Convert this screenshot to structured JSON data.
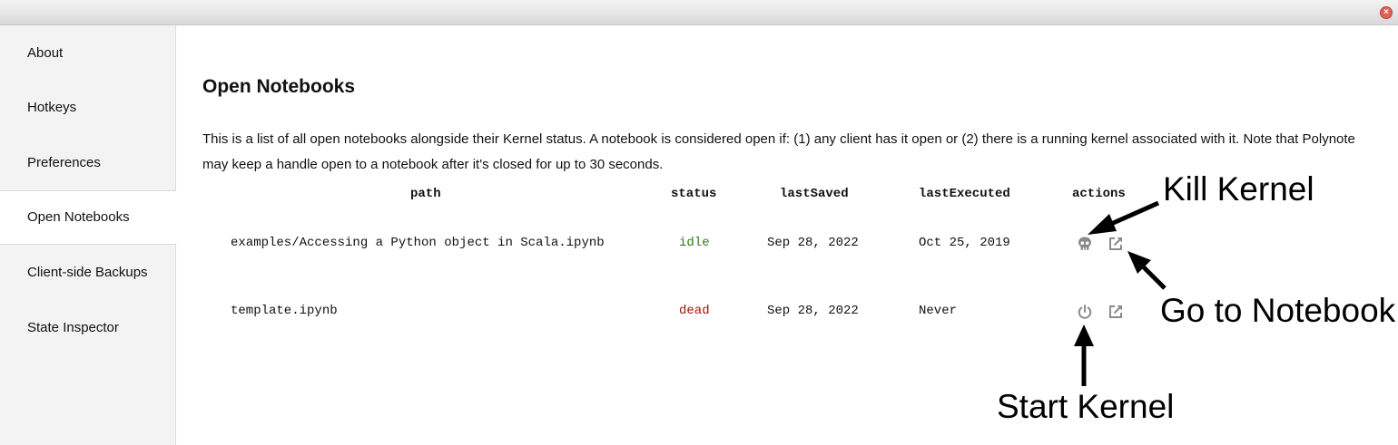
{
  "window": {
    "close_icon": "close-icon"
  },
  "sidebar": {
    "items": [
      {
        "label": "About",
        "active": false
      },
      {
        "label": "Hotkeys",
        "active": false
      },
      {
        "label": "Preferences",
        "active": false
      },
      {
        "label": "Open Notebooks",
        "active": true
      },
      {
        "label": "Client-side Backups",
        "active": false
      },
      {
        "label": "State Inspector",
        "active": false
      }
    ]
  },
  "main": {
    "title": "Open Notebooks",
    "description": "This is a list of all open notebooks alongside their Kernel status. A notebook is considered open if: (1) any client has it open or (2) there is a running kernel associated with it. Note that Polynote may keep a handle open to a notebook after it's closed for up to 30 seconds.",
    "table": {
      "headers": [
        "path",
        "status",
        "lastSaved",
        "lastExecuted",
        "actions"
      ],
      "rows": [
        {
          "path": "examples/Accessing a Python object in Scala.ipynb",
          "status": "idle",
          "lastSaved": "Sep 28, 2022",
          "lastExecuted": "Oct 25, 2019",
          "actions": [
            "skull-icon",
            "external-link-icon"
          ]
        },
        {
          "path": "template.ipynb",
          "status": "dead",
          "lastSaved": "Sep 28, 2022",
          "lastExecuted": "Never",
          "actions": [
            "power-icon",
            "external-link-icon"
          ]
        }
      ]
    }
  },
  "annotations": {
    "kill_kernel": "Kill Kernel",
    "go_to_notebook": "Go to Notebook",
    "start_kernel": "Start Kernel"
  },
  "colors": {
    "status_idle": "#2e7d1a",
    "status_dead": "#a80f0f",
    "icon": "#8a8a8a",
    "sidebar_bg": "#f3f3f3"
  }
}
